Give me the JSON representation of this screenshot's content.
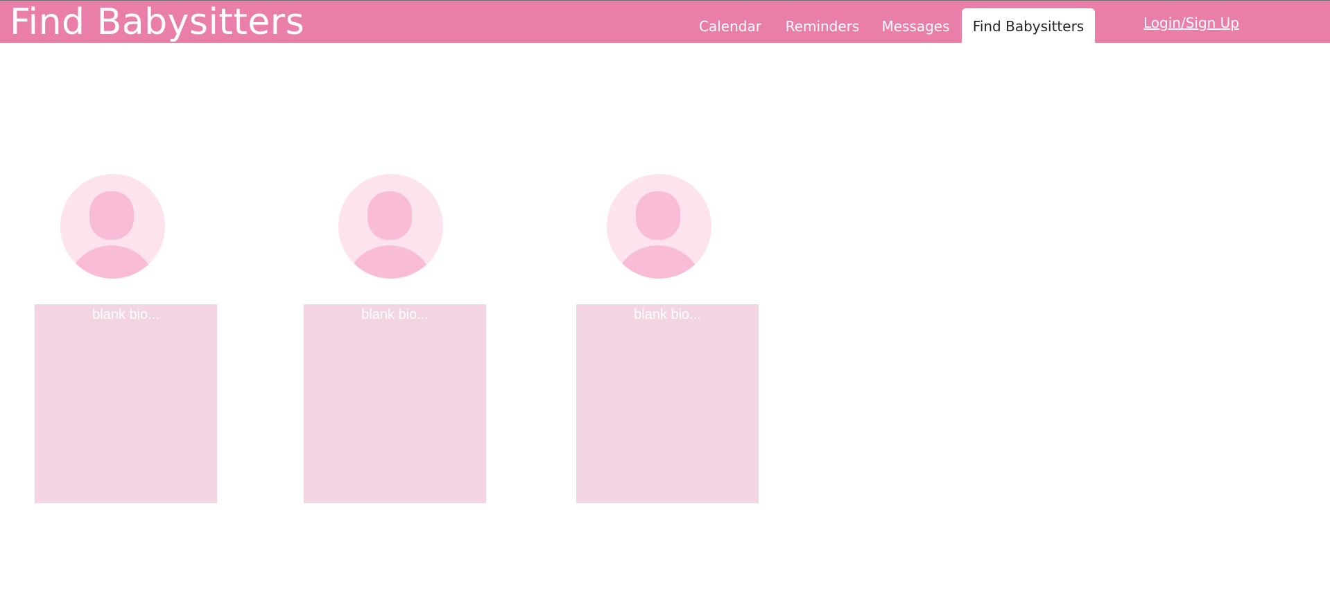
{
  "header": {
    "title": "Find Babysitters",
    "background_color": "#e97ea9",
    "nav_tabs": [
      {
        "label": "Calendar",
        "active": false
      },
      {
        "label": "Reminders",
        "active": false
      },
      {
        "label": "Messages",
        "active": false
      },
      {
        "label": "Find Babysitters",
        "active": true
      }
    ],
    "login_label": "Login/Sign Up"
  },
  "babysitters": [
    {
      "avatar_icon": "default-user-avatar-icon",
      "bio": "blank bio..."
    },
    {
      "avatar_icon": "default-user-avatar-icon",
      "bio": "blank bio..."
    },
    {
      "avatar_icon": "default-user-avatar-icon",
      "bio": "blank bio..."
    }
  ],
  "colors": {
    "avatar_background": "#fde3ee",
    "avatar_figure": "#f9bcd7",
    "bio_background": "#f2d4e3"
  }
}
